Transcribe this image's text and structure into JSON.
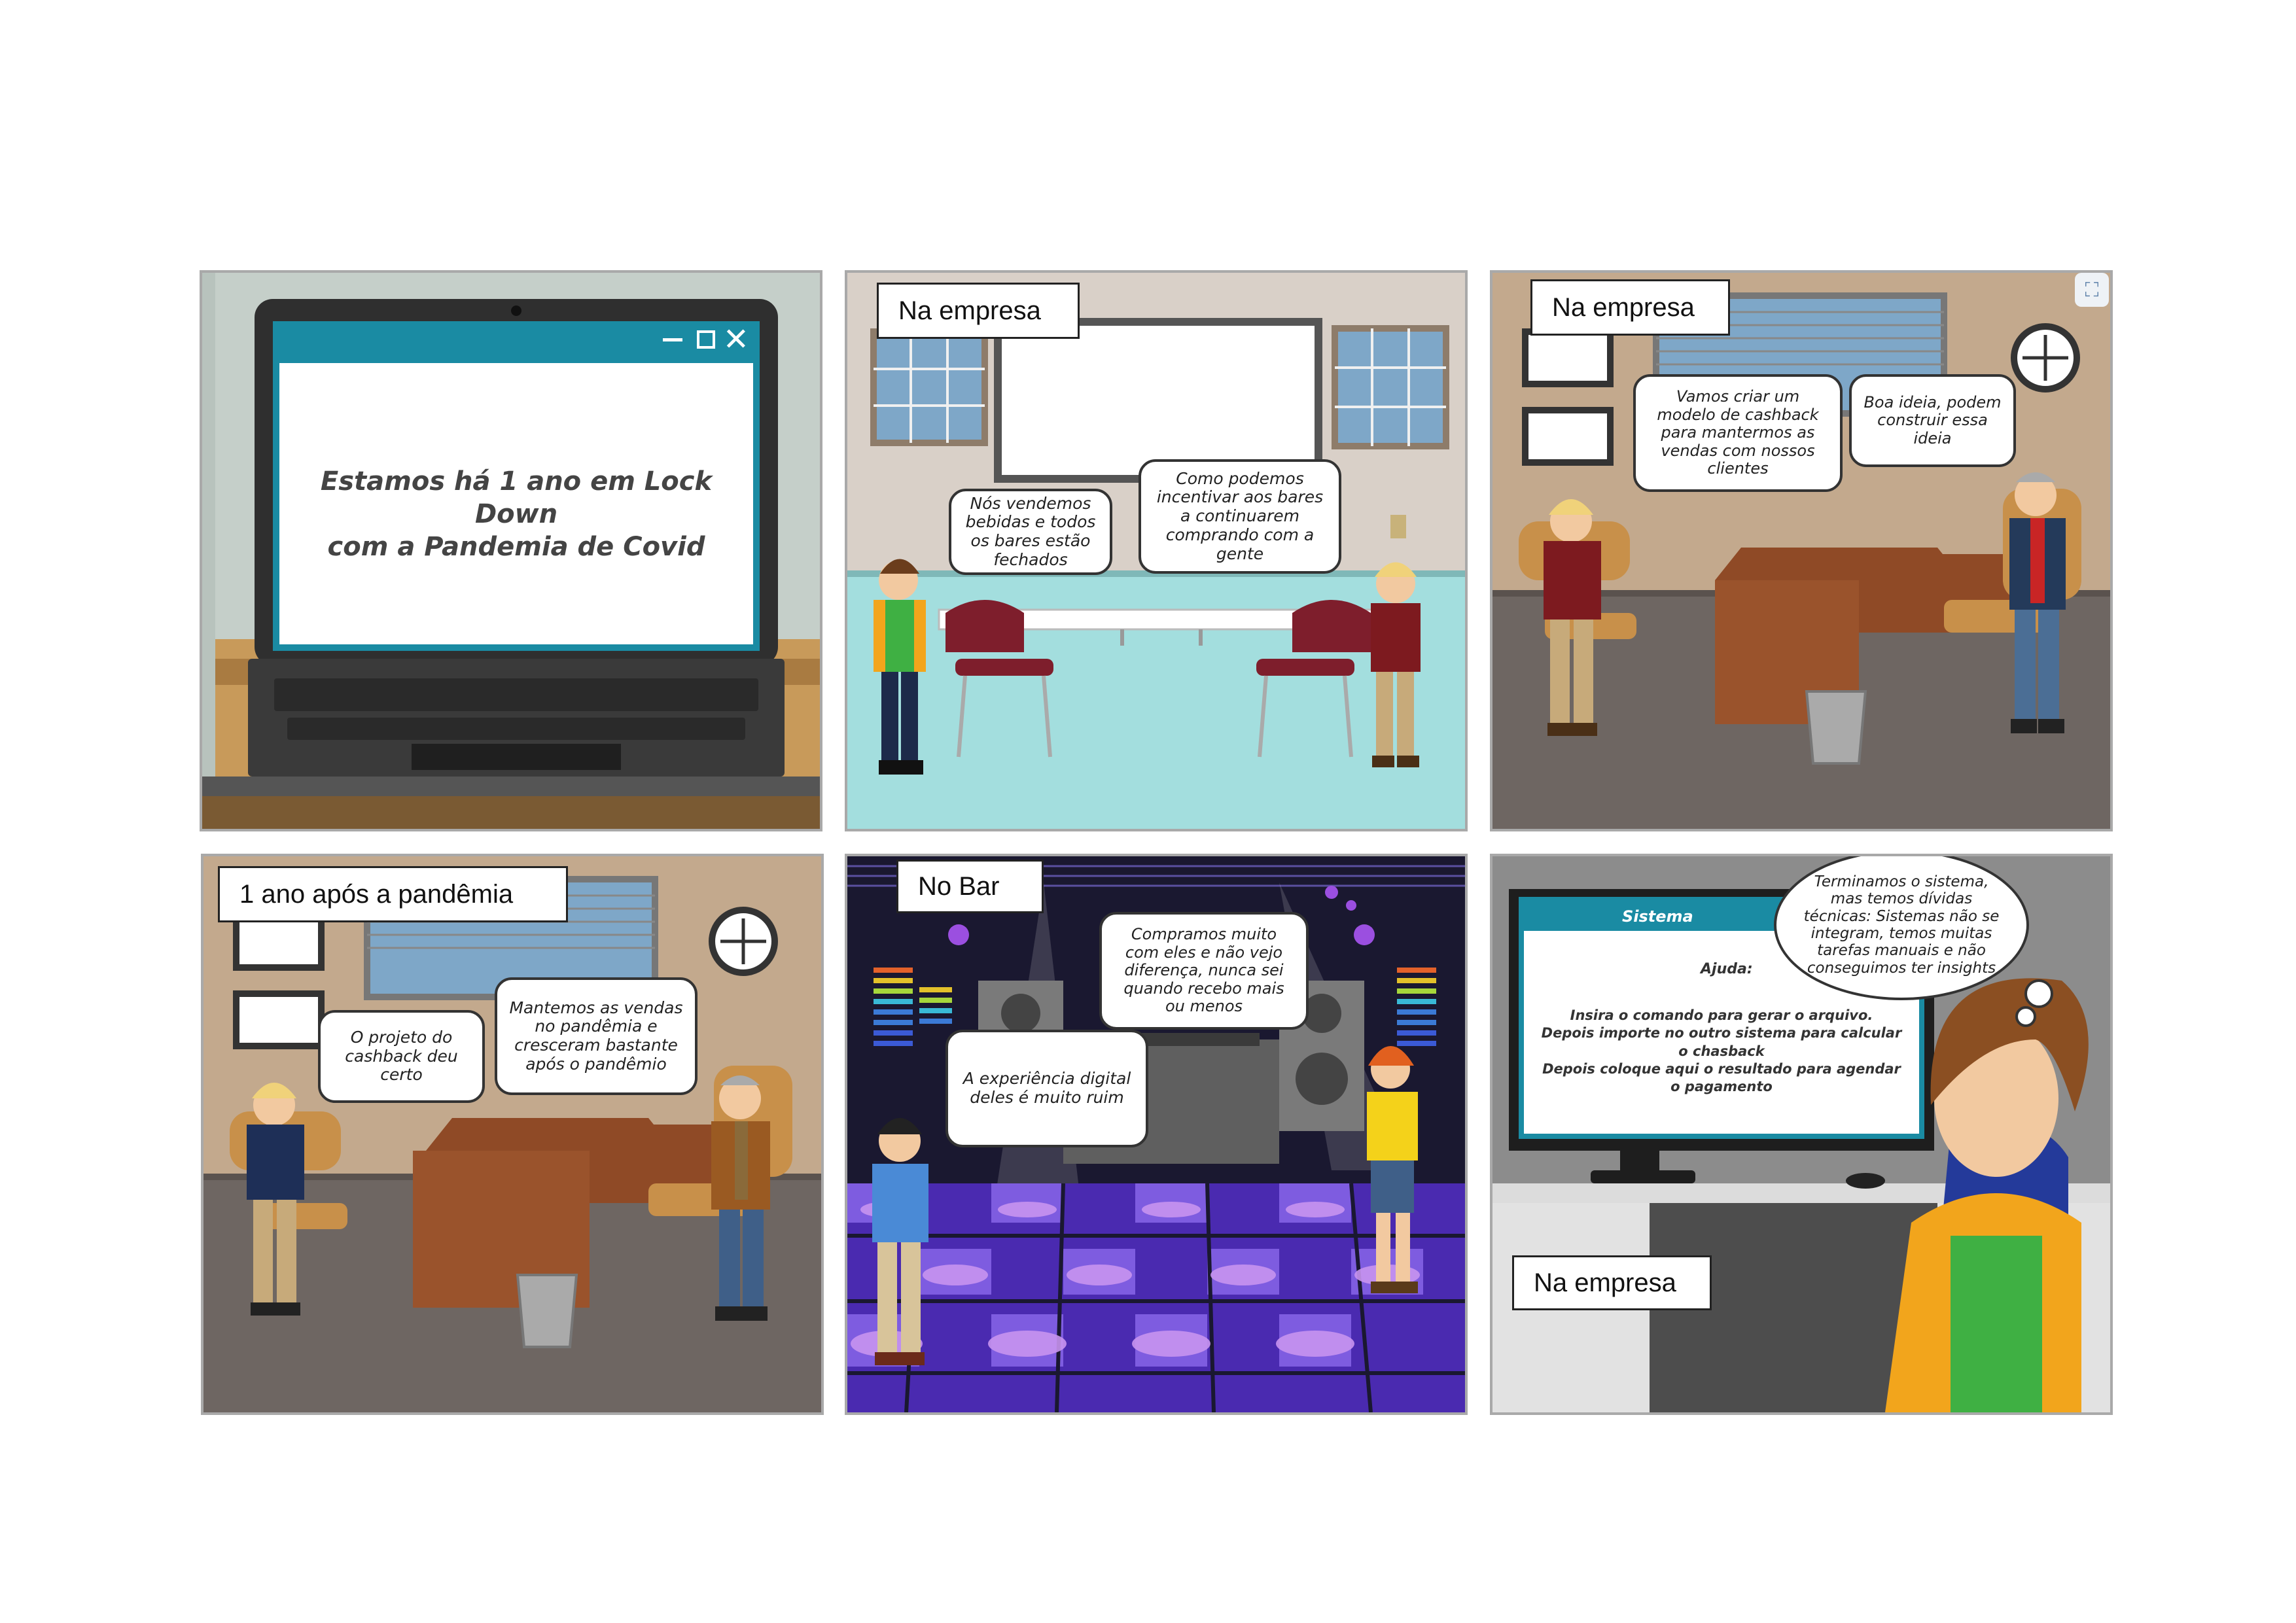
{
  "panels": [
    {
      "laptop": {
        "text_line1": "Estamos há 1 ano em Lock Down",
        "text_line2": "com a Pandemia de Covid"
      }
    },
    {
      "caption": "Na empresa",
      "bubbles": [
        "Nós vendemos bebidas e todos os bares estão fechados",
        "Como podemos incentivar aos bares a continuarem comprando com a gente"
      ]
    },
    {
      "caption": "Na empresa",
      "bubbles": [
        "Vamos criar um modelo de cashback para mantermos as vendas com nossos clientes",
        "Boa ideia, podem construir essa ideia"
      ]
    },
    {
      "caption": "1 ano após a pandêmia",
      "bubbles": [
        "O projeto do cashback deu certo",
        "Mantemos as vendas no pandêmia e cresceram bastante após o pandêmio"
      ]
    },
    {
      "caption": "No Bar",
      "bubbles": [
        "Compramos muito com eles e não vejo diferença, nunca sei quando recebo mais ou menos",
        "A experiência digital deles é muito ruim"
      ]
    },
    {
      "caption": "Na empresa",
      "screen": {
        "title": "Sistema",
        "help_label": "Ajuda:",
        "line1": "Insira o comando para gerar o arquivo.",
        "line2": "Depois importe no outro sistema para calcular o chasback",
        "line3": "Depois coloque aqui o resultado para agendar o pagamento"
      },
      "thought": "Terminamos o sistema, mas temos dívidas técnicas: Sistemas não se integram, temos muitas tarefas manuais e não conseguimos ter insights"
    }
  ]
}
